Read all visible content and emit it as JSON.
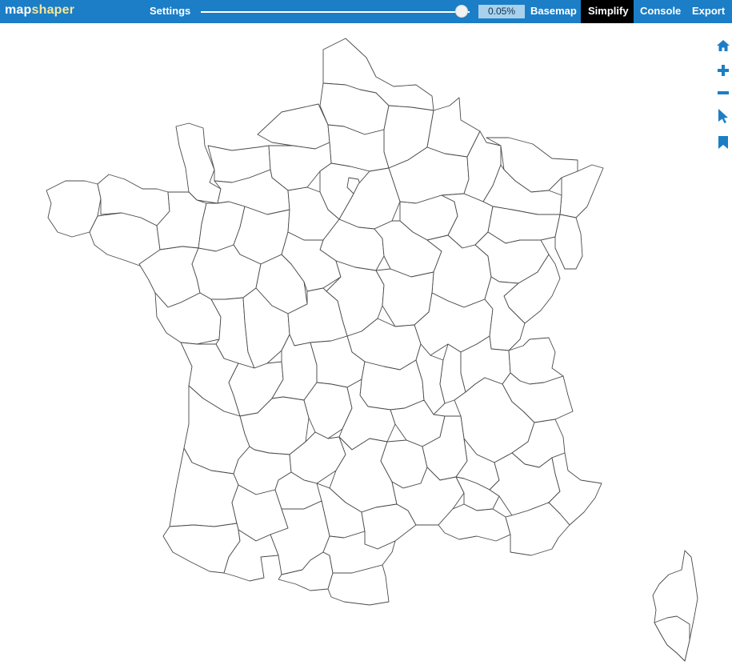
{
  "app": {
    "logo_part1": "map",
    "logo_part2": "shaper"
  },
  "toolbar": {
    "settings_label": "Settings",
    "simplify_percent": "0.05%",
    "slider_fraction": 0.97,
    "basemap_label": "Basemap",
    "simplify_label": "Simplify",
    "console_label": "Console",
    "export_label": "Export"
  },
  "side_tools": {
    "icons": [
      "home-icon",
      "zoom-in-icon",
      "zoom-out-icon",
      "pointer-icon",
      "bookmark-icon"
    ]
  },
  "colors": {
    "topbar": "#1c7ec6",
    "active_tab": "#000000",
    "logo_accent": "#f4e79d",
    "percent_box": "#a9d1ec",
    "tool_icon": "#1c7ec6",
    "boundary_stroke": "#4a4a4a"
  },
  "map": {
    "layer": "France departments"
  }
}
